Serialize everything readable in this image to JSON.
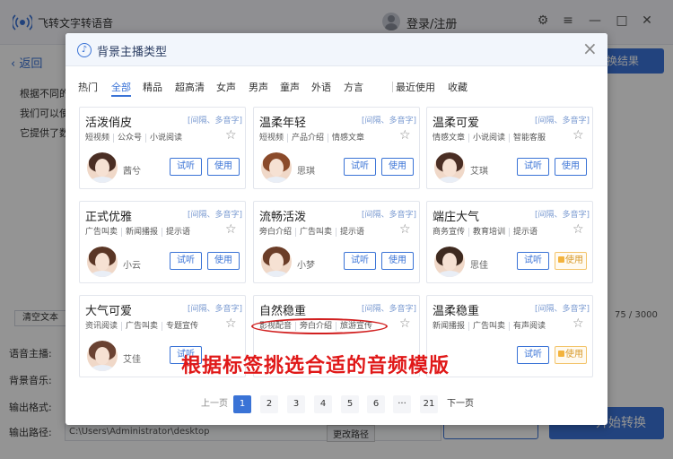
{
  "app": {
    "name": "飞转文字转语音",
    "login": "登录/注册"
  },
  "body": {
    "back": "返回",
    "desc_lines": [
      "根据不同的",
      "我们可以使",
      "它提供了数"
    ],
    "export_label": "换结果",
    "clear_label": "清空文本",
    "char_count": "75 / 3000",
    "labels": {
      "voice": "语音主播:",
      "music": "背景音乐:",
      "format": "输出格式:",
      "path": "输出路径:"
    },
    "path_value": "C:\\Users\\Administrator\\desktop",
    "change_path": "更改路径",
    "start_convert": "开始转换"
  },
  "modal": {
    "title": "背景主播类型",
    "tabs": [
      {
        "label": "热门",
        "active": false
      },
      {
        "label": "全部",
        "active": true
      },
      {
        "label": "精品",
        "active": false
      },
      {
        "label": "超高清",
        "active": false
      },
      {
        "label": "女声",
        "active": false
      },
      {
        "label": "男声",
        "active": false
      },
      {
        "label": "童声",
        "active": false
      },
      {
        "label": "外语",
        "active": false
      },
      {
        "label": "方言",
        "active": false
      },
      {
        "label": "最近使用",
        "active": false
      },
      {
        "label": "收藏",
        "active": false
      }
    ],
    "try_label": "试听",
    "use_label": "使用",
    "cards": [
      {
        "title": "活泼俏皮",
        "feature": "[间隔、多音字]",
        "tags": [
          "短视频",
          "公众号",
          "小说阅读"
        ],
        "name": "茜兮",
        "vip": false
      },
      {
        "title": "温柔年轻",
        "feature": "[间隔、多音字]",
        "tags": [
          "短视频",
          "产品介绍",
          "情感文章"
        ],
        "name": "思琪",
        "vip": false
      },
      {
        "title": "温柔可爱",
        "feature": "[间隔、多音字]",
        "tags": [
          "情感文章",
          "小说阅读",
          "智能客服"
        ],
        "name": "艾琪",
        "vip": false
      },
      {
        "title": "正式优雅",
        "feature": "[间隔、多音字]",
        "tags": [
          "广告叫卖",
          "新闻播报",
          "提示语"
        ],
        "name": "小云",
        "vip": false
      },
      {
        "title": "流畅活泼",
        "feature": "[间隔、多音字]",
        "tags": [
          "旁白介绍",
          "广告叫卖",
          "提示语"
        ],
        "name": "小梦",
        "vip": false
      },
      {
        "title": "端庄大气",
        "feature": "[间隔、多音字]",
        "tags": [
          "商务宣传",
          "教育培训",
          "提示语"
        ],
        "name": "思佳",
        "vip": true
      },
      {
        "title": "大气可爱",
        "feature": "[间隔、多音字]",
        "tags": [
          "资讯阅读",
          "广告叫卖",
          "专题宣传"
        ],
        "name": "艾佳",
        "vip": false
      },
      {
        "title": "自然稳重",
        "feature": "[间隔、多音字]",
        "tags": [
          "影视配音",
          "旁白介绍",
          "旅游宣传"
        ],
        "name": "",
        "vip": false
      },
      {
        "title": "温柔稳重",
        "feature": "[间隔、多音字]",
        "tags": [
          "新闻播报",
          "广告叫卖",
          "有声阅读"
        ],
        "name": "",
        "vip": true
      }
    ],
    "pagination": {
      "prev": "上一页",
      "pages": [
        "1",
        "2",
        "3",
        "4",
        "5",
        "6",
        "···",
        "21"
      ],
      "next": "下一页",
      "current": "1"
    }
  },
  "caption": "根据标签挑选合适的音频模版",
  "colors": {
    "accent": "#3a73d6",
    "caption": "#e01818",
    "vip": "#f3b33d"
  }
}
